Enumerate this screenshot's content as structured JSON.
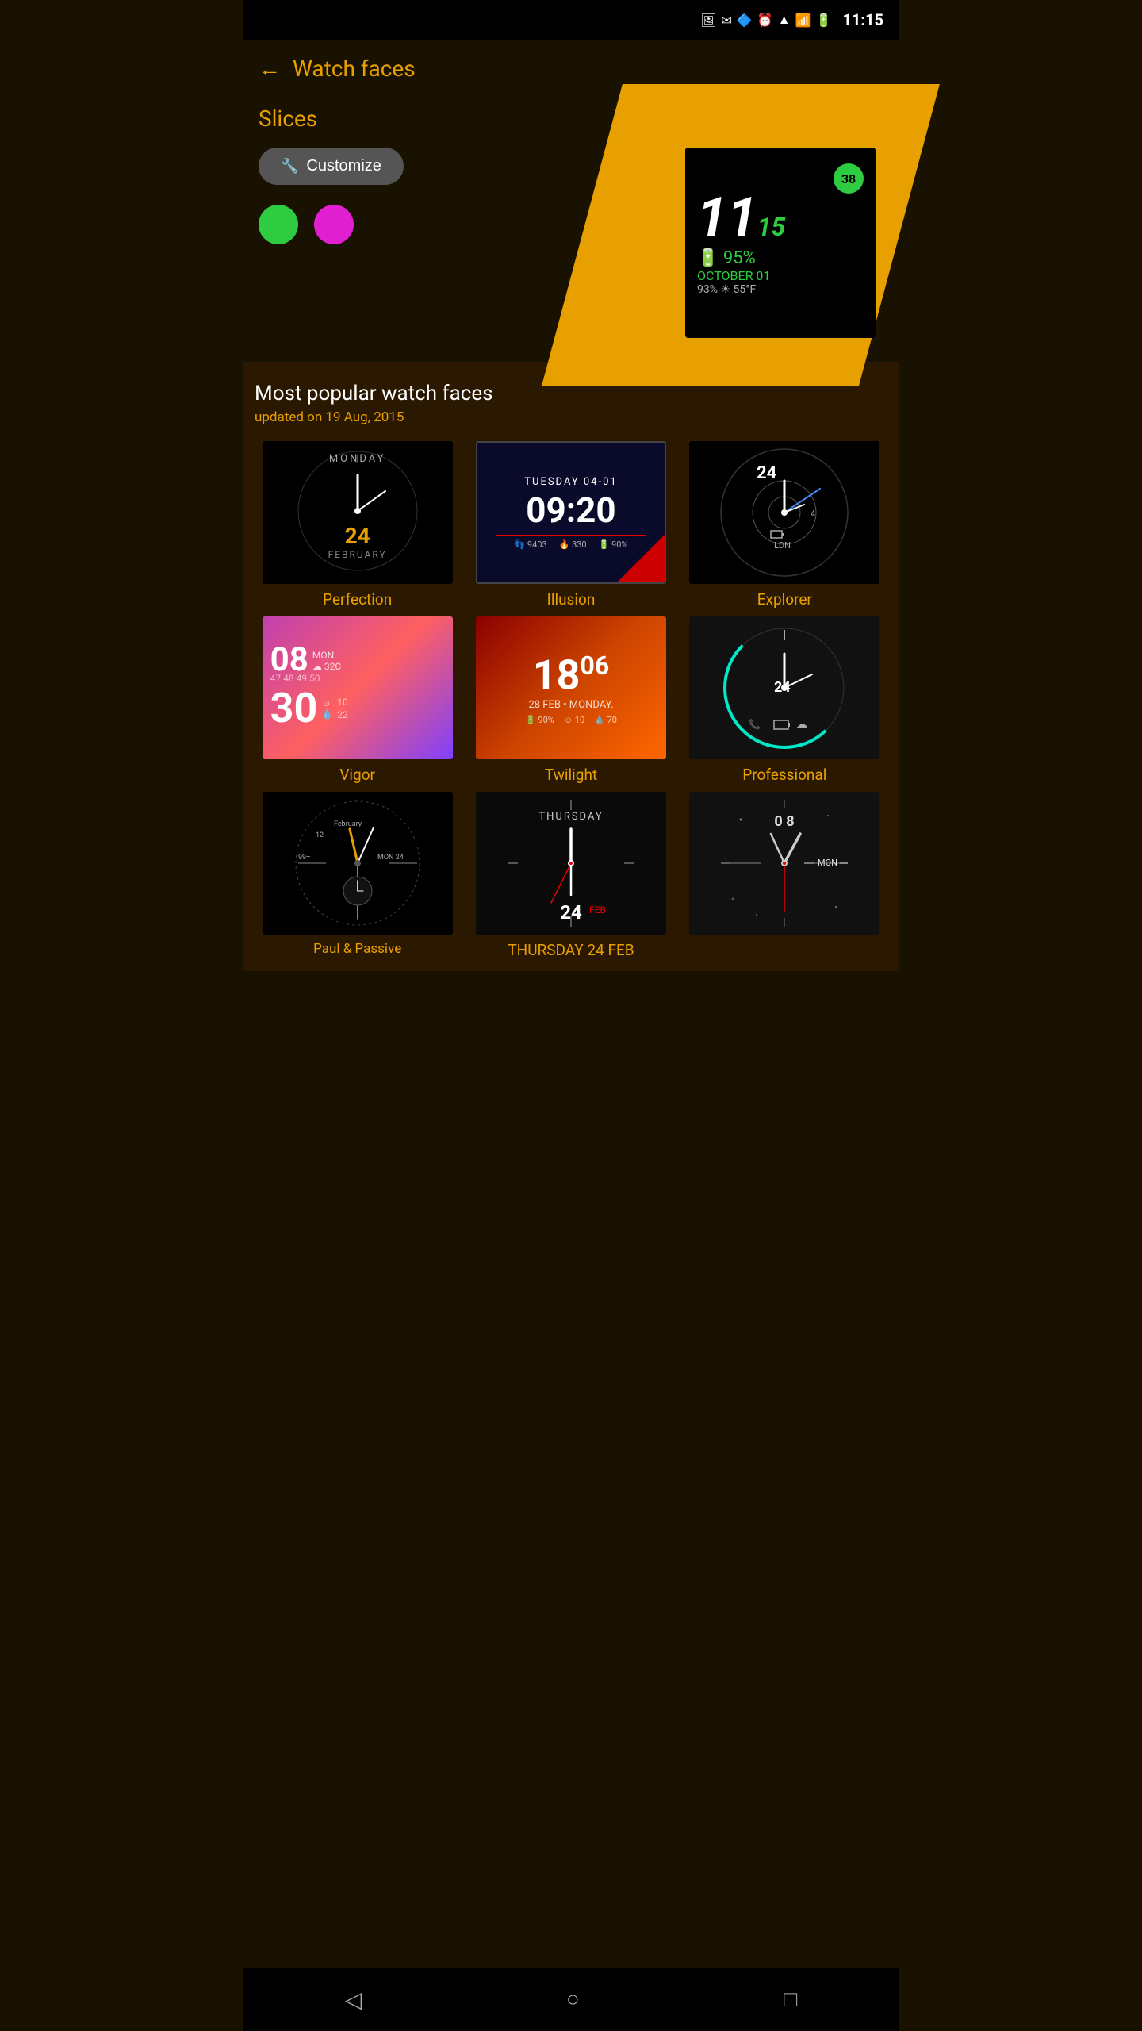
{
  "statusBar": {
    "time": "11:15",
    "icons": [
      "gallery",
      "mail",
      "bluetooth",
      "alarm",
      "wifi",
      "signal",
      "battery"
    ]
  },
  "header": {
    "backLabel": "←",
    "title": "Watch faces"
  },
  "slices": {
    "label": "Slices",
    "customizeBtn": "Customize",
    "preview": {
      "time": "11",
      "timeSmall": "15",
      "date": "OCTOBER 01",
      "battery": "95%",
      "charge": "93%",
      "temp": "55°F",
      "badge": "38"
    }
  },
  "popular": {
    "title": "Most popular watch faces",
    "subtitle": "updated on 19 Aug, 2015",
    "faces": [
      {
        "id": "perfection",
        "name": "Perfection",
        "day": "MONDAY",
        "date": "24",
        "month": "FEBRUARY"
      },
      {
        "id": "illusion",
        "name": "Illusion",
        "dateStr": "TUESDAY 04-01",
        "time": "09:20",
        "stats": [
          "9403",
          "330",
          "90%"
        ]
      },
      {
        "id": "explorer",
        "name": "Explorer",
        "num": "24",
        "location": "LDN"
      },
      {
        "id": "vigor",
        "name": "Vigor",
        "time": "08",
        "minutes": "30",
        "day": "MON",
        "temp": "32C"
      },
      {
        "id": "twilight",
        "name": "Twilight",
        "time": "18 06",
        "date": "28 FEB • MONDAY.",
        "stats": [
          "90%",
          "10",
          "70"
        ]
      },
      {
        "id": "professional",
        "name": "Professional",
        "num": "24"
      },
      {
        "id": "dark1",
        "name": "Paul & Passive",
        "detail": "Feb MON 24"
      },
      {
        "id": "thursday",
        "name": "THURSDAY 24 FEB",
        "day": "THURSDAY",
        "date": "24",
        "month": "FEB"
      },
      {
        "id": "dark3",
        "name": "",
        "num": "08",
        "day": "MON"
      }
    ]
  },
  "bottomNav": {
    "back": "◁",
    "home": "○",
    "recent": "□"
  }
}
